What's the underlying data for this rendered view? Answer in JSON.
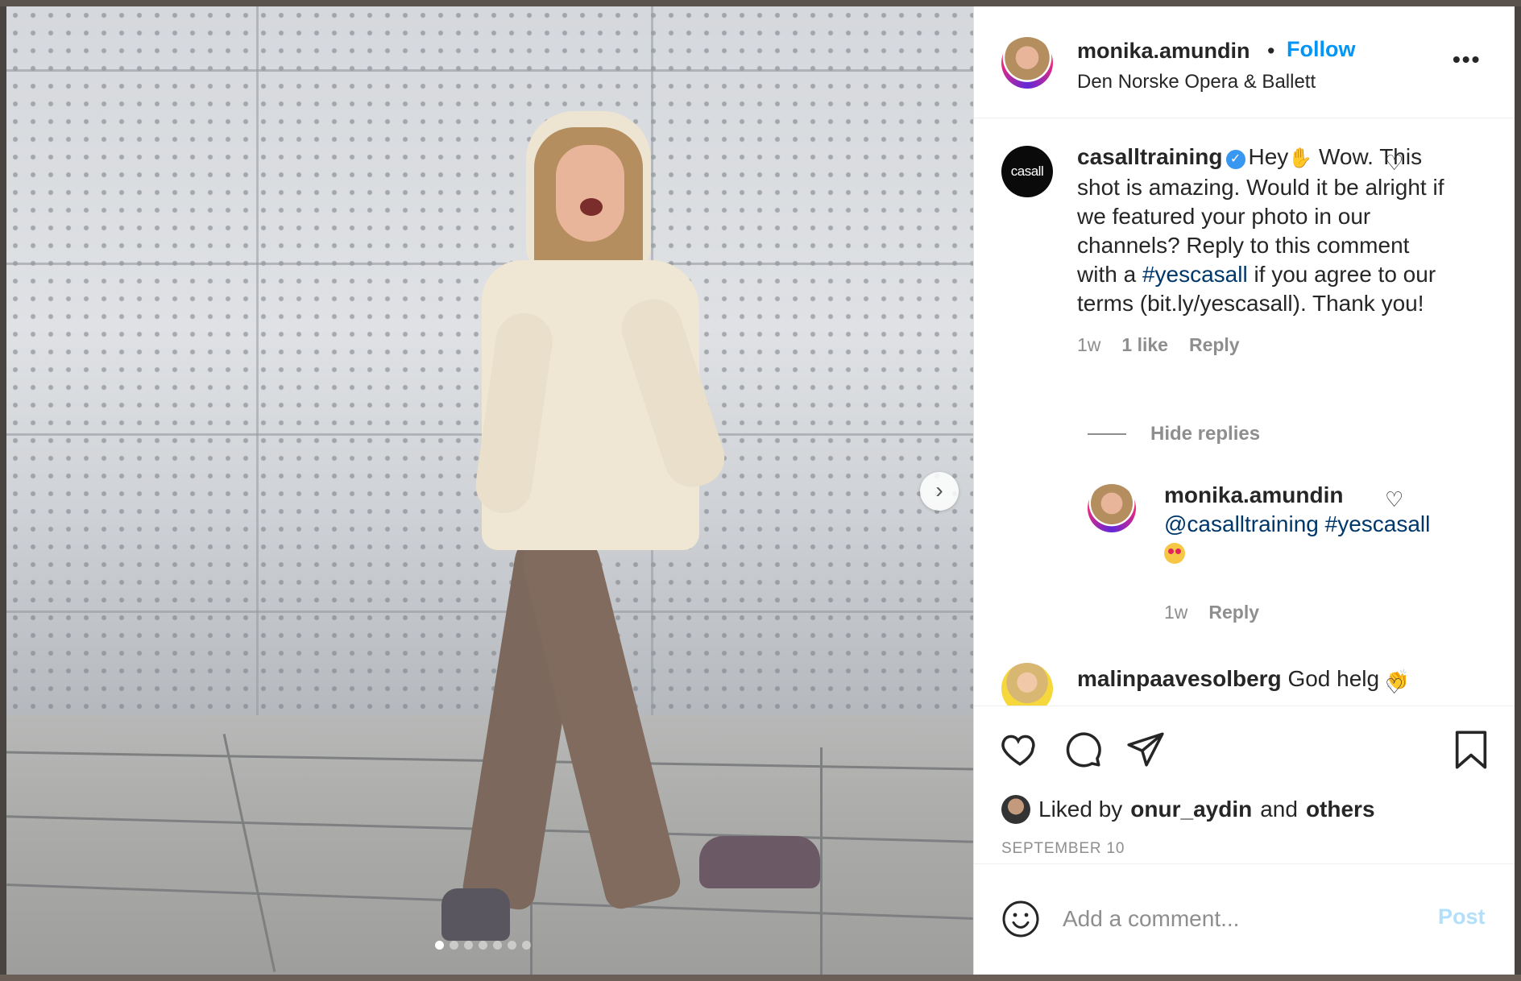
{
  "post": {
    "author": "monika.amundin",
    "separator": "•",
    "follow_label": "Follow",
    "location": "Den Norske Opera & Ballett",
    "more_label": "•••",
    "carousel_dots": 7,
    "active_dot": 0,
    "next_label": "›"
  },
  "comments": [
    {
      "avatar_text": "casall",
      "username": "casalltraining",
      "verified": true,
      "text_a": "Hey",
      "text_b": " Wow. This shot is amazing. Would it be alright if we featured your photo in our channels? Reply to this comment with a ",
      "hashtag": "#yescasall",
      "text_c": " if you agree to our terms (bit.ly/yescasall). Thank you!",
      "time": "1w",
      "likes": "1 like",
      "reply_label": "Reply",
      "hide_replies": "Hide replies",
      "replies": [
        {
          "username": "monika.amundin",
          "mention": "@casalltraining",
          "hashtag": "#yescasall",
          "time": "1w",
          "reply_label": "Reply"
        }
      ]
    },
    {
      "username": "malinpaavesolberg",
      "text": "God helg"
    }
  ],
  "actions": {
    "liked_prefix": "Liked by",
    "liked_user": "onur_aydin",
    "liked_and": "and",
    "liked_others": "others",
    "date": "SEPTEMBER 10"
  },
  "add_comment": {
    "placeholder": "Add a comment...",
    "post_label": "Post"
  },
  "colors": {
    "accent": "#0095f6",
    "hashtag": "#00376b",
    "muted": "#8e8e8e",
    "verified": "#3897f0"
  }
}
